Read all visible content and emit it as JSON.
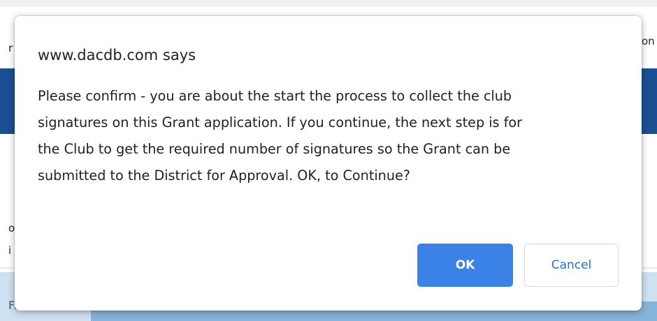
{
  "background": {
    "left_fragments": [
      "r",
      "o",
      "i"
    ],
    "right_fragment": "on",
    "bottom_tab_partial": "Fr..."
  },
  "dialog": {
    "title": "www.dacdb.com says",
    "message": "Please confirm - you are about the start the process to collect the club\nsignatures on this Grant application. If you continue, the next step is for\nthe Club to get the required number of signatures so the Grant can be\nsubmitted to the District for Approval.  OK, to Continue?",
    "ok_label": "OK",
    "cancel_label": "Cancel"
  },
  "colors": {
    "primary_button": "#3b82e6",
    "cancel_text": "#1f6fd8",
    "header_bar": "#1b4f91"
  }
}
